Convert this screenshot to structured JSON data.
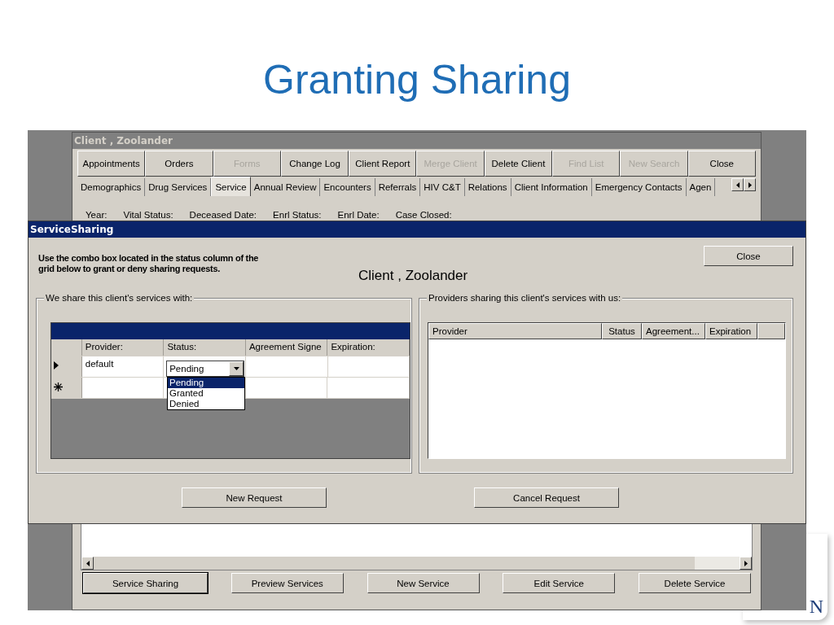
{
  "slide": {
    "title": "Granting Sharing",
    "logo_fragment": "N"
  },
  "app_window": {
    "title": "Client , Zoolander",
    "buttons": [
      {
        "label": "Appointments",
        "disabled": false
      },
      {
        "label": "Orders",
        "disabled": false
      },
      {
        "label": "Forms",
        "disabled": true
      },
      {
        "label": "Change Log",
        "disabled": false
      },
      {
        "label": "Client Report",
        "disabled": false
      },
      {
        "label": "Merge Client",
        "disabled": true
      },
      {
        "label": "Delete Client",
        "disabled": false
      },
      {
        "label": "Find List",
        "disabled": true
      },
      {
        "label": "New Search",
        "disabled": true
      },
      {
        "label": "Close",
        "disabled": false
      }
    ],
    "tabs": [
      {
        "label": "Demographics",
        "selected": false
      },
      {
        "label": "Drug Services",
        "selected": false
      },
      {
        "label": "Service",
        "selected": true
      },
      {
        "label": "Annual Review",
        "selected": false
      },
      {
        "label": "Encounters",
        "selected": false
      },
      {
        "label": "Referrals",
        "selected": false
      },
      {
        "label": "HIV C&T",
        "selected": false
      },
      {
        "label": "Relations",
        "selected": false
      },
      {
        "label": "Client Information",
        "selected": false
      },
      {
        "label": "Emergency Contacts",
        "selected": false
      },
      {
        "label": "Agen",
        "selected": false
      }
    ],
    "field_labels": [
      "Year:",
      "Vital Status:",
      "Deceased Date:",
      "Enrl Status:",
      "Enrl Date:",
      "Case Closed:"
    ],
    "bottom_buttons": [
      {
        "label": "Service Sharing",
        "focused": true
      },
      {
        "label": "Preview Services",
        "focused": false
      },
      {
        "label": "New Service",
        "focused": false
      },
      {
        "label": "Edit Service",
        "focused": false
      },
      {
        "label": "Delete Service",
        "focused": false
      }
    ]
  },
  "dialog": {
    "title": "ServiceSharing",
    "instructions": "Use the combo box located in the status column of the grid below to grant or deny sharing requests.",
    "client_name": "Client , Zoolander",
    "close_button": "Close",
    "outgoing": {
      "legend": "We share this client's services with:",
      "columns": [
        "Provider:",
        "Status:",
        "Agreement Signe",
        "Expiration:"
      ],
      "rows": [
        {
          "kind": "current",
          "provider": "default",
          "status": "Pending"
        },
        {
          "kind": "new"
        }
      ],
      "status_dropdown": {
        "expanded": true,
        "options": [
          {
            "label": "Pending",
            "selected": true
          },
          {
            "label": "Granted",
            "selected": false
          },
          {
            "label": "Denied",
            "selected": false
          }
        ]
      }
    },
    "incoming": {
      "legend": "Providers sharing this client's services with us:",
      "columns": [
        "Provider",
        "Status",
        "Agreement...",
        "Expiration"
      ]
    },
    "buttons": [
      "New Request",
      "Cancel Request"
    ]
  }
}
